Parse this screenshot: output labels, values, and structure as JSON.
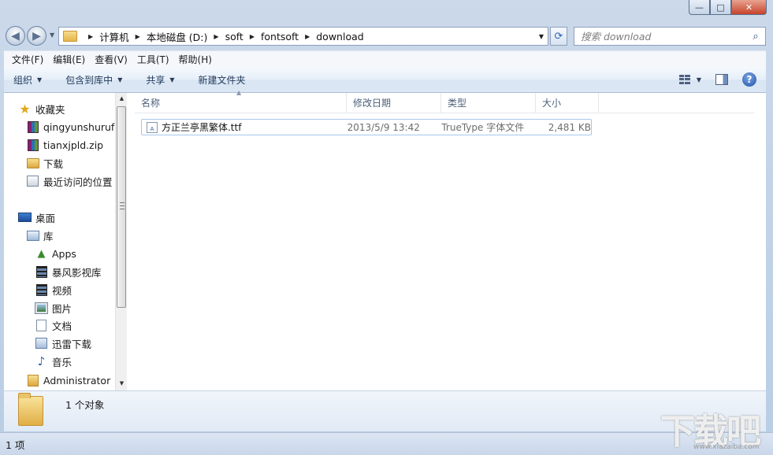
{
  "window": {
    "minimize_glyph": "—",
    "maximize_glyph": "□",
    "close_glyph": "✕"
  },
  "nav": {
    "back_glyph": "◀",
    "forward_glyph": "▶",
    "breadcrumb": [
      "计算机",
      "本地磁盘 (D:)",
      "soft",
      "fontsoft",
      "download"
    ]
  },
  "search": {
    "placeholder": "搜索 download"
  },
  "menu": [
    "文件(F)",
    "编辑(E)",
    "查看(V)",
    "工具(T)",
    "帮助(H)"
  ],
  "toolbar": {
    "organize": "组织",
    "include_in_library": "包含到库中",
    "share": "共享",
    "new_folder": "新建文件夹"
  },
  "sidebar": {
    "items": [
      {
        "label": "收藏夹",
        "icon": "star-icon"
      },
      {
        "label": "qingyunshurufa",
        "icon": "archive-icon"
      },
      {
        "label": "tianxjpld.zip",
        "icon": "archive-icon"
      },
      {
        "label": "下载",
        "icon": "folder-icon"
      },
      {
        "label": "最近访问的位置",
        "icon": "recent-places-icon"
      },
      {
        "label": "桌面",
        "icon": "desktop-icon"
      },
      {
        "label": "库",
        "icon": "library-icon"
      },
      {
        "label": "Apps",
        "icon": "apps-icon"
      },
      {
        "label": "暴风影视库",
        "icon": "video-library-icon"
      },
      {
        "label": "视频",
        "icon": "video-icon"
      },
      {
        "label": "图片",
        "icon": "picture-icon"
      },
      {
        "label": "文档",
        "icon": "document-icon"
      },
      {
        "label": "迅雷下载",
        "icon": "download-library-icon"
      },
      {
        "label": "音乐",
        "icon": "music-icon"
      },
      {
        "label": "Administrator",
        "icon": "user-folder-icon"
      }
    ]
  },
  "columns": {
    "name": "名称",
    "modified": "修改日期",
    "type": "类型",
    "size": "大小"
  },
  "files": [
    {
      "name": "方正兰亭黑繁体.ttf",
      "modified": "2013/5/9 13:42",
      "type": "TrueType 字体文件",
      "size": "2,481 KB",
      "icon": "font-file-icon"
    }
  ],
  "details": {
    "count_text": "1 个对象"
  },
  "status": {
    "text": "1 项"
  },
  "watermark": {
    "text": "下载吧",
    "sub": "www.xiazaiba.com"
  }
}
